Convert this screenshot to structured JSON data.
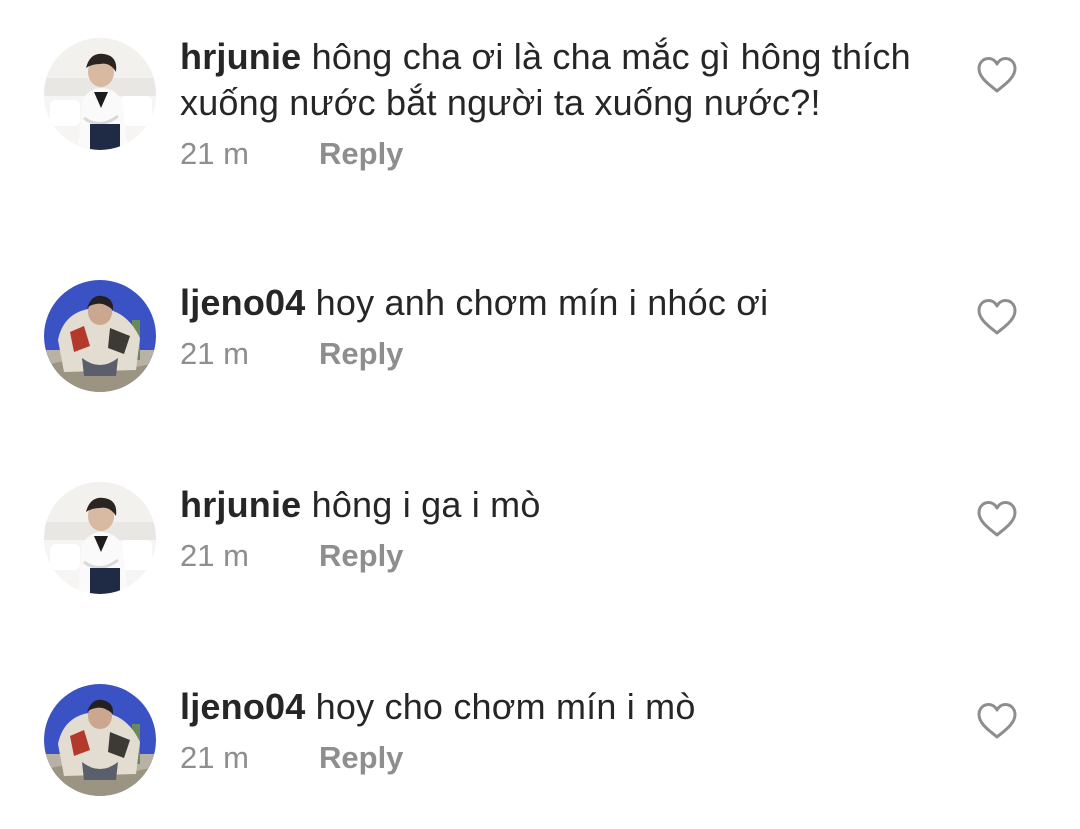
{
  "comments": [
    {
      "username": "hrjunie",
      "text": "hông cha ơi là cha mắc gì hông thích xuống nước bắt người ta xuống nước?!",
      "time": "21 m",
      "reply_label": "Reply",
      "avatar_icon": "avatar-hrjunie",
      "like_icon": "heart-outline-icon"
    },
    {
      "username": "ljeno04",
      "text": "hoy anh chơm mín i nhóc ơi",
      "time": "21 m",
      "reply_label": "Reply",
      "avatar_icon": "avatar-ljeno04",
      "like_icon": "heart-outline-icon"
    },
    {
      "username": "hrjunie",
      "text": "hông i ga i mò",
      "time": "21 m",
      "reply_label": "Reply",
      "avatar_icon": "avatar-hrjunie",
      "like_icon": "heart-outline-icon"
    },
    {
      "username": "ljeno04",
      "text": "hoy cho chơm mín i mò",
      "time": "21 m",
      "reply_label": "Reply",
      "avatar_icon": "avatar-ljeno04",
      "like_icon": "heart-outline-icon"
    }
  ],
  "colors": {
    "text": "#262626",
    "secondary": "#8e8e8e",
    "background": "#ffffff"
  }
}
